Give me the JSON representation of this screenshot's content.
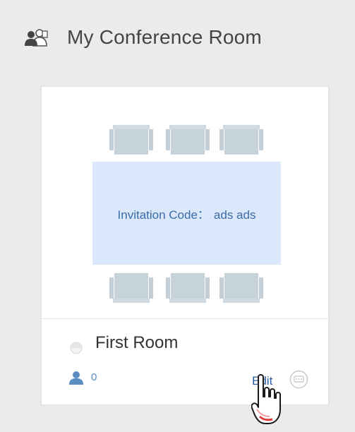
{
  "header": {
    "icon": "conference-users-icon",
    "title": "My Conference Room"
  },
  "room_card": {
    "table": {
      "invitation_label": "Invitation Code：",
      "invitation_code": "ads ads"
    },
    "room_name": "First Room",
    "participant_count": "0",
    "edit_label": "Edit",
    "icons": {
      "status": "room-status-dot-icon",
      "participants": "person-icon",
      "chat": "chat-bubble-icon",
      "cursor": "hand-pointer-icon"
    }
  },
  "colors": {
    "background": "#ebebeb",
    "table": "#dbe7fb",
    "chair": "#c7d3db",
    "link": "#2c5f9e"
  }
}
